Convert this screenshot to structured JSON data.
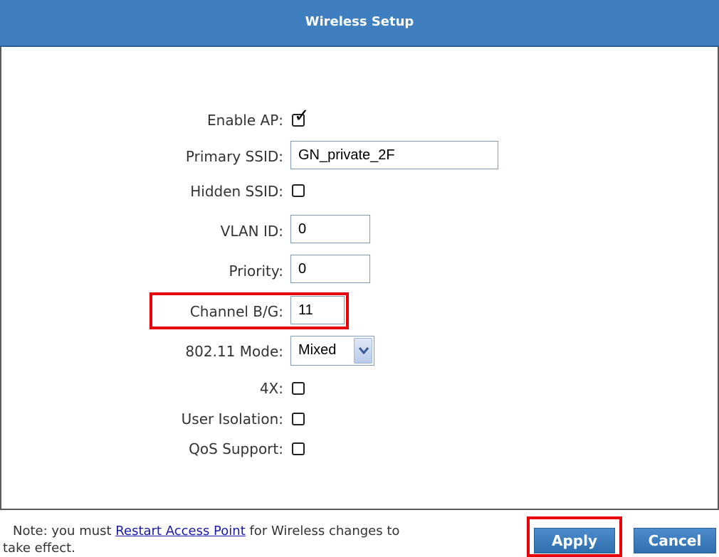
{
  "header": {
    "title": "Wireless Setup"
  },
  "form": {
    "enable_ap": {
      "label": "Enable AP:",
      "checked": true
    },
    "primary_ssid": {
      "label": "Primary SSID:",
      "value": "GN_private_2F"
    },
    "hidden_ssid": {
      "label": "Hidden SSID:",
      "checked": false
    },
    "vlan_id": {
      "label": "VLAN ID:",
      "value": "0"
    },
    "priority": {
      "label": "Priority:",
      "value": "0"
    },
    "channel_bg": {
      "label": "Channel B/G:",
      "value": "11"
    },
    "mode": {
      "label": "802.11 Mode:",
      "value": "Mixed"
    },
    "four_x": {
      "label": "4X:",
      "checked": false
    },
    "user_isolation": {
      "label": "User Isolation:",
      "checked": false
    },
    "qos_support": {
      "label": "QoS Support:",
      "checked": false
    }
  },
  "footer": {
    "note_prefix": "Note: you must ",
    "note_link": "Restart Access Point",
    "note_suffix": " for Wireless changes to",
    "note_line2": "take effect.",
    "apply_label": "Apply",
    "cancel_label": "Cancel"
  },
  "colors": {
    "header_bg": "#3f7fbf",
    "highlight": "#e8000b",
    "link": "#1a1aa6"
  },
  "icons": {
    "checkmark": "checkmark-icon",
    "dropdown": "chevron-down-icon"
  }
}
